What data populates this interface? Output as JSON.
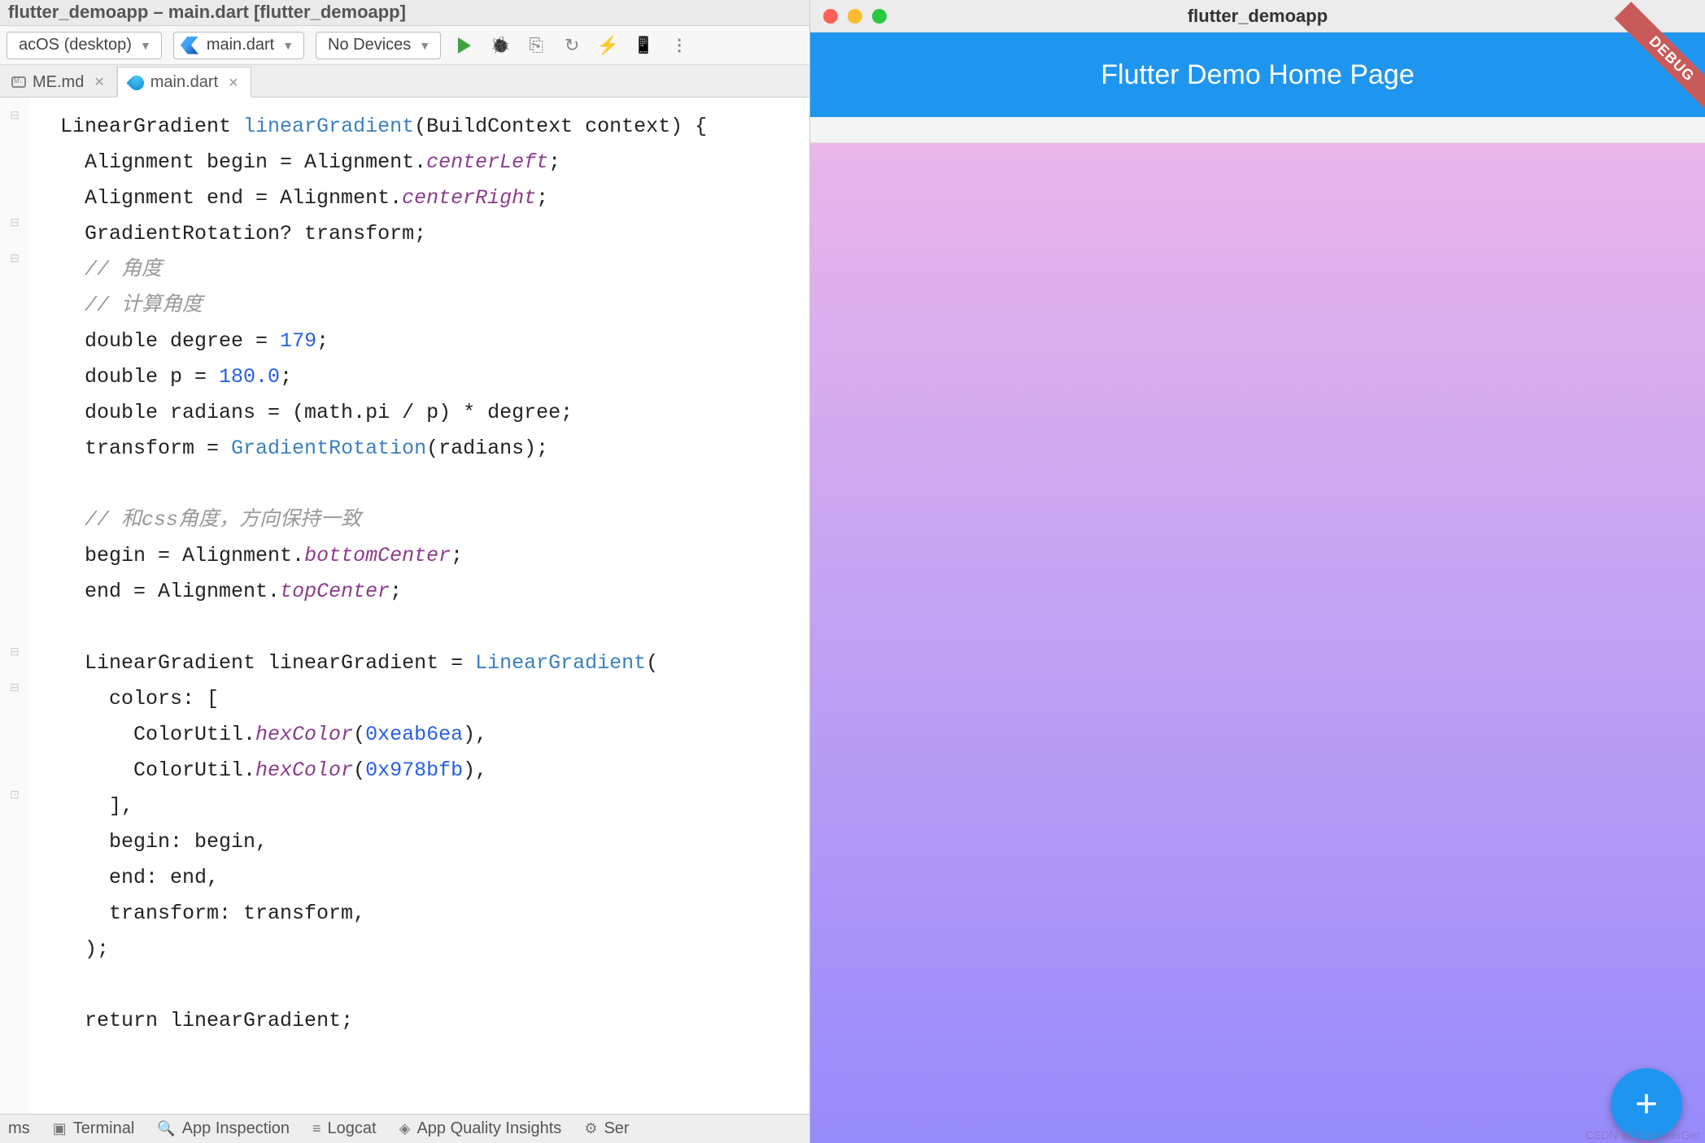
{
  "window_title": "flutter_demoapp – main.dart [flutter_demoapp]",
  "toolbar": {
    "target": "acOS (desktop)",
    "run_config": "main.dart",
    "devices": "No Devices"
  },
  "tabs": [
    {
      "label": "ME.md",
      "active": false
    },
    {
      "label": "main.dart",
      "active": true
    }
  ],
  "code": {
    "line1_a": "  LinearGradient ",
    "line1_fn": "linearGradient",
    "line1_b": "(BuildContext context) {",
    "line2_a": "    Alignment begin = Alignment.",
    "line2_enm": "centerLeft",
    "line2_b": ";",
    "line3_a": "    Alignment end = Alignment.",
    "line3_enm": "centerRight",
    "line3_b": ";",
    "line4": "    GradientRotation? transform;",
    "line5": "    // 角度",
    "line6": "    // 计算角度",
    "line7_a": "    double degree = ",
    "line7_num": "179",
    "line7_b": ";",
    "line8_a": "    double p = ",
    "line8_num": "180.0",
    "line8_b": ";",
    "line9": "    double radians = (math.pi / p) * degree;",
    "line10_a": "    transform = ",
    "line10_cls": "GradientRotation",
    "line10_b": "(radians);",
    "line11": "",
    "line12": "    // 和css角度，方向保持一致",
    "line13_a": "    begin = Alignment.",
    "line13_enm": "bottomCenter",
    "line13_b": ";",
    "line14_a": "    end = Alignment.",
    "line14_enm": "topCenter",
    "line14_b": ";",
    "line15": "",
    "line16_a": "    LinearGradient linearGradient = ",
    "line16_cls": "LinearGradient",
    "line16_b": "(",
    "line17": "      colors: [",
    "line18_a": "        ColorUtil.",
    "line18_mth": "hexColor",
    "line18_b": "(",
    "line18_num": "0xeab6ea",
    "line18_c": "),",
    "line19_a": "        ColorUtil.",
    "line19_mth": "hexColor",
    "line19_b": "(",
    "line19_num": "0x978bfb",
    "line19_c": "),",
    "line20": "      ],",
    "line21": "      begin: begin,",
    "line22": "      end: end,",
    "line23": "      transform: transform,",
    "line24": "    );",
    "line25": "",
    "line26_a": "    ",
    "line26_kw": "return",
    "line26_b": " linearGradient;"
  },
  "bottom_tabs": {
    "problems": "ms",
    "terminal": "Terminal",
    "app_inspection": "App Inspection",
    "logcat": "Logcat",
    "quality": "App Quality Insights",
    "services": "Ser"
  },
  "app": {
    "mac_title": "flutter_demoapp",
    "appbar_title": "Flutter Demo Home Page",
    "debug_banner": "DEBUG",
    "fab_symbol": "+",
    "watermark": "CSDN @BruceGerGer"
  }
}
